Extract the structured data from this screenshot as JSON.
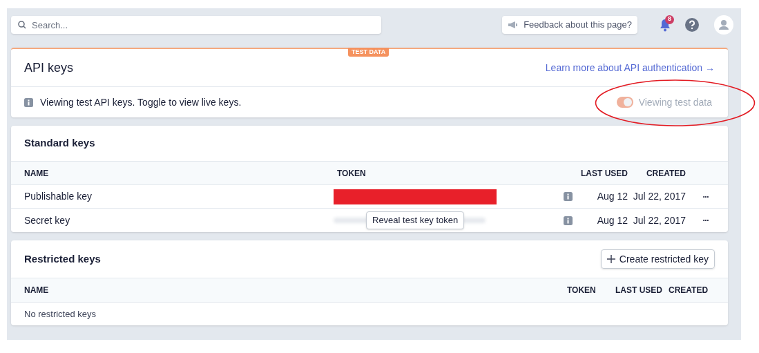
{
  "topbar": {
    "search": {
      "placeholder": "Search..."
    },
    "feedback": "Feedback about this page?",
    "notifications": "8"
  },
  "api_keys": {
    "badge": "TEST DATA",
    "title": "API keys",
    "link": "Learn more about API authentication →",
    "notice": "Viewing test API keys. Toggle to view live keys.",
    "toggle": {
      "label": "Viewing test data",
      "on": true
    }
  },
  "standard_keys": {
    "title": "Standard keys",
    "columns": [
      "NAME",
      "TOKEN",
      "LAST USED",
      "CREATED"
    ],
    "rows": [
      {
        "name": "Publishable key",
        "kind": "redacted",
        "last_used": "Aug 12",
        "created": "Jul 22, 2017",
        "menu": "•••"
      },
      {
        "name": "Secret key",
        "kind": "hidden",
        "tooltip": "Reveal test key token",
        "last_used": "Aug 12",
        "created": "Jul 22, 2017",
        "menu": "•••"
      }
    ]
  },
  "restricted_keys": {
    "title": "Restricted keys",
    "button": "Create restricted key",
    "columns": [
      "NAME",
      "TOKEN",
      "LAST USED",
      "CREATED"
    ],
    "empty": "No restricted keys"
  }
}
